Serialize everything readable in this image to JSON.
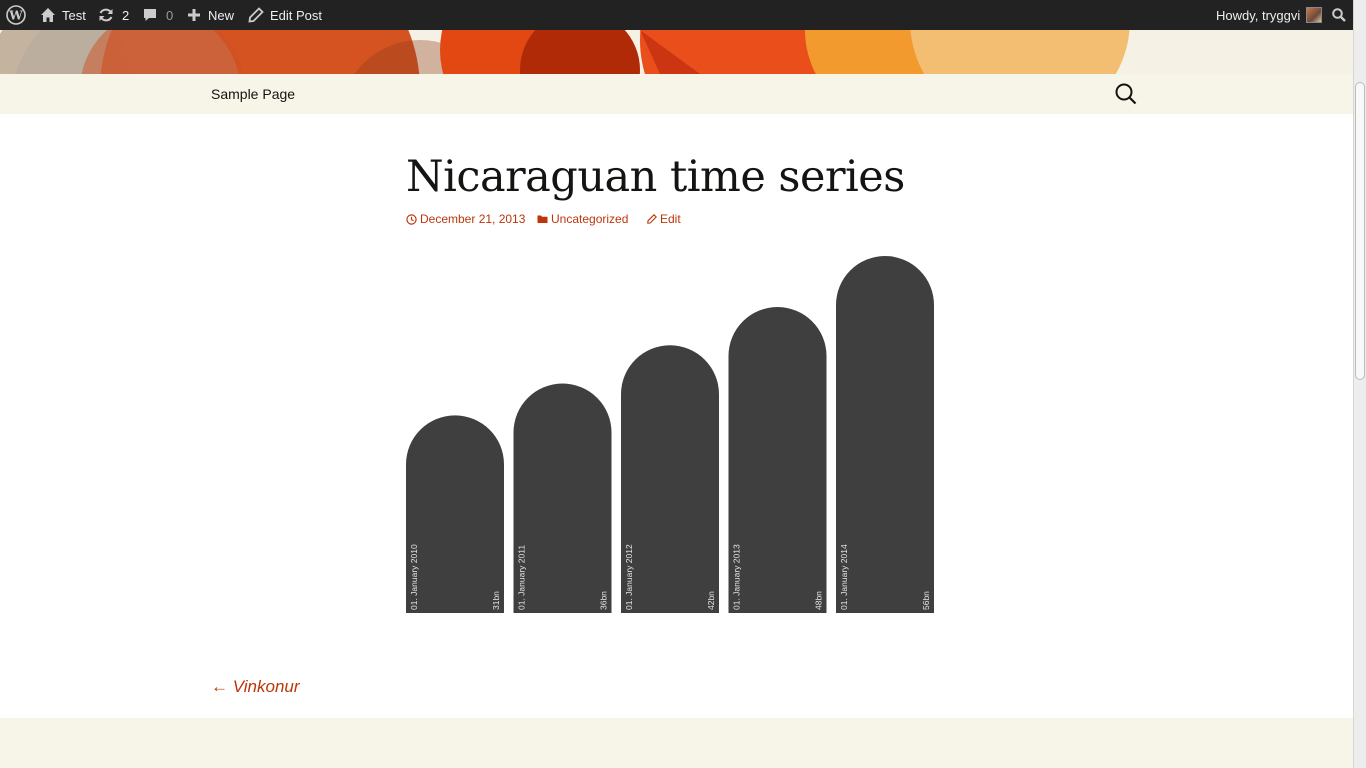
{
  "adminbar": {
    "site_name": "Test",
    "updates_count": "2",
    "comments_count": "0",
    "new_label": "New",
    "edit_post_label": "Edit Post",
    "howdy": "Howdy, tryggvi"
  },
  "nav": {
    "menu_item": "Sample Page"
  },
  "post": {
    "title": "Nicaraguan time series",
    "date": "December 21, 2013",
    "category": "Uncategorized",
    "edit_label": "Edit"
  },
  "chart_data": {
    "type": "bar",
    "categories": [
      "01. January 2010",
      "01. January 2011",
      "01. January 2012",
      "01. January 2013",
      "01. January 2014"
    ],
    "values": [
      31,
      36,
      42,
      48,
      56
    ],
    "value_labels": [
      "31bn",
      "36bn",
      "42bn",
      "48bn",
      "56bn"
    ],
    "bar_color": "#3f3f3f",
    "label_color": "#e6e6e6",
    "ylim": [
      0,
      56
    ]
  },
  "post_nav": {
    "previous": "← Vinkonur"
  },
  "colors": {
    "accent": "#bc360a",
    "adminbar_bg": "#222222",
    "navbar_bg": "#f7f5e7"
  }
}
